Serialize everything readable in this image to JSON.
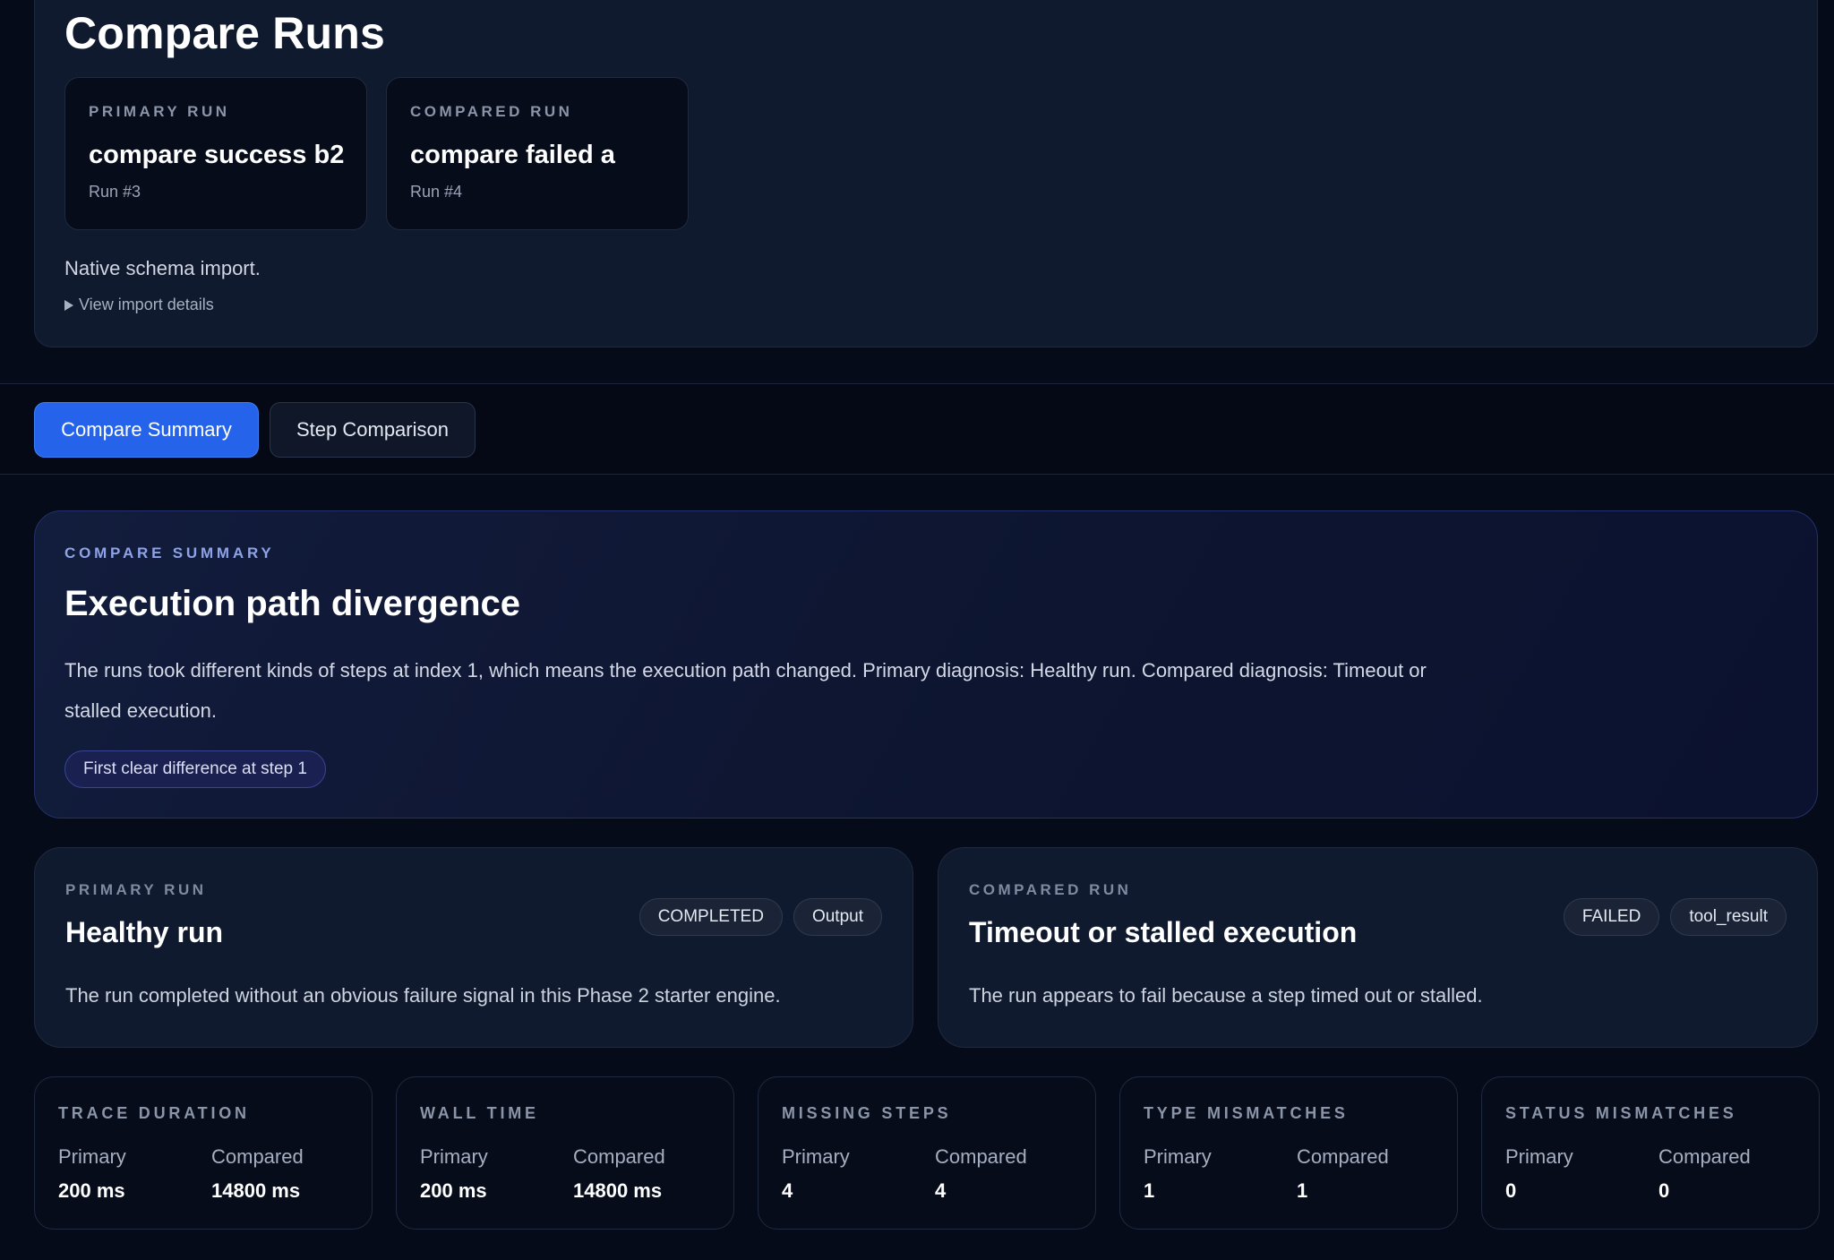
{
  "header": {
    "title": "Compare Runs",
    "primary": {
      "kicker": "PRIMARY RUN",
      "name": "compare success b2",
      "run": "Run #3"
    },
    "compared": {
      "kicker": "COMPARED RUN",
      "name": "compare failed a",
      "run": "Run #4"
    },
    "note": "Native schema import.",
    "details_toggle": "View import details"
  },
  "tabs": [
    {
      "label": "Compare Summary",
      "active": true
    },
    {
      "label": "Step Comparison",
      "active": false
    }
  ],
  "summary": {
    "kicker": "COMPARE SUMMARY",
    "title": "Execution path divergence",
    "text": "The runs took different kinds of steps at index 1, which means the execution path changed. Primary diagnosis: Healthy run. Compared diagnosis: Timeout or stalled execution.",
    "pill": "First clear difference at step 1"
  },
  "diagnosis": {
    "primary": {
      "kicker": "PRIMARY RUN",
      "title": "Healthy run",
      "desc": "The run completed without an obvious failure signal in this Phase 2 starter engine.",
      "badges": [
        "COMPLETED",
        "Output"
      ]
    },
    "compared": {
      "kicker": "COMPARED RUN",
      "title": "Timeout or stalled execution",
      "desc": "The run appears to fail because a step timed out or stalled.",
      "badges": [
        "FAILED",
        "tool_result"
      ]
    }
  },
  "metrics": [
    {
      "kicker": "TRACE DURATION",
      "primary_label": "Primary",
      "compared_label": "Compared",
      "primary": "200 ms",
      "compared": "14800 ms"
    },
    {
      "kicker": "WALL TIME",
      "primary_label": "Primary",
      "compared_label": "Compared",
      "primary": "200 ms",
      "compared": "14800 ms"
    },
    {
      "kicker": "MISSING STEPS",
      "primary_label": "Primary",
      "compared_label": "Compared",
      "primary": "4",
      "compared": "4"
    },
    {
      "kicker": "TYPE MISMATCHES",
      "primary_label": "Primary",
      "compared_label": "Compared",
      "primary": "1",
      "compared": "1"
    },
    {
      "kicker": "STATUS MISMATCHES",
      "primary_label": "Primary",
      "compared_label": "Compared",
      "primary": "0",
      "compared": "0"
    }
  ],
  "colors": {
    "background": "#060b19",
    "panel": "#101a2e",
    "accent": "#2563eb",
    "summary_kicker": "#8ea3e6"
  }
}
